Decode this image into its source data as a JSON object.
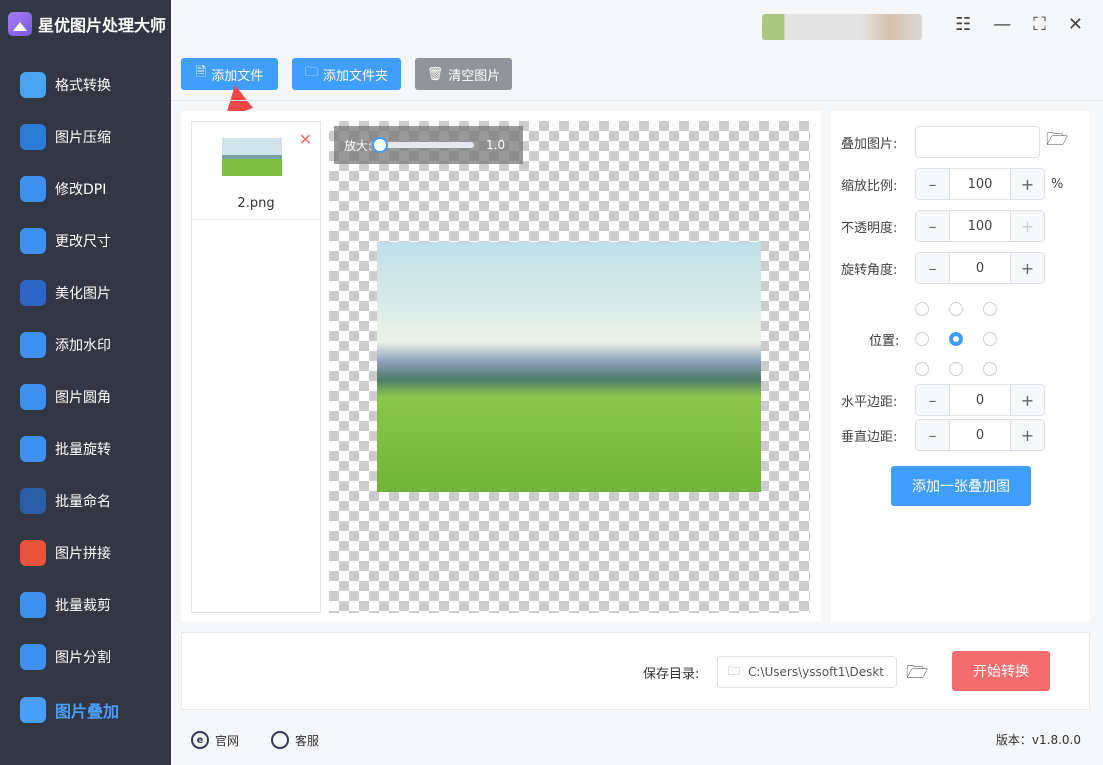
{
  "app": {
    "title": "星优图片处理大师"
  },
  "sidebar": {
    "items": [
      {
        "label": "格式转换",
        "color": "#4aa3f0"
      },
      {
        "label": "图片压缩",
        "color": "#2d7dd8"
      },
      {
        "label": "修改DPI",
        "color": "#3d8ff0"
      },
      {
        "label": "更改尺寸",
        "color": "#3d8ff0"
      },
      {
        "label": "美化图片",
        "color": "#2d66c8"
      },
      {
        "label": "添加水印",
        "color": "#3d8ff0"
      },
      {
        "label": "图片圆角",
        "color": "#3d8ff0"
      },
      {
        "label": "批量旋转",
        "color": "#3d8ff0"
      },
      {
        "label": "批量命名",
        "color": "#2a5fa8"
      },
      {
        "label": "图片拼接",
        "color": "#e8543a"
      },
      {
        "label": "批量裁剪",
        "color": "#3d8ff0"
      },
      {
        "label": "图片分割",
        "color": "#3d8ff0"
      },
      {
        "label": "图片叠加",
        "color": "#4a9eff"
      }
    ],
    "active": "图片叠加"
  },
  "toolbar": {
    "add_file": "添加文件",
    "add_folder": "添加文件夹",
    "clear": "清空图片"
  },
  "files": [
    {
      "name": "2.png"
    }
  ],
  "preview": {
    "zoom_label": "放大:",
    "zoom_value": "1.0"
  },
  "overlay": {
    "image_label": "叠加图片:",
    "image_value": "",
    "scale_label": "缩放比例:",
    "scale_value": "100",
    "scale_unit": "%",
    "opacity_label": "不透明度:",
    "opacity_value": "100",
    "rotate_label": "旋转角度:",
    "rotate_value": "0",
    "position_label": "位置:",
    "position_selected": "center",
    "hmargin_label": "水平边距:",
    "hmargin_value": "0",
    "vmargin_label": "垂直边距:",
    "vmargin_value": "0",
    "add_button": "添加一张叠加图",
    "minus": "–",
    "plus": "+"
  },
  "output": {
    "save_label": "保存目录:",
    "save_path": "C:\\Users\\yssoft1\\Deskt",
    "start_button": "开始转换"
  },
  "footer": {
    "website": "官网",
    "support": "客服",
    "version": "版本：v1.8.0.0"
  },
  "colors": {
    "accent": "#409eff",
    "danger": "#f56c6c",
    "sidebar": "#333744"
  }
}
